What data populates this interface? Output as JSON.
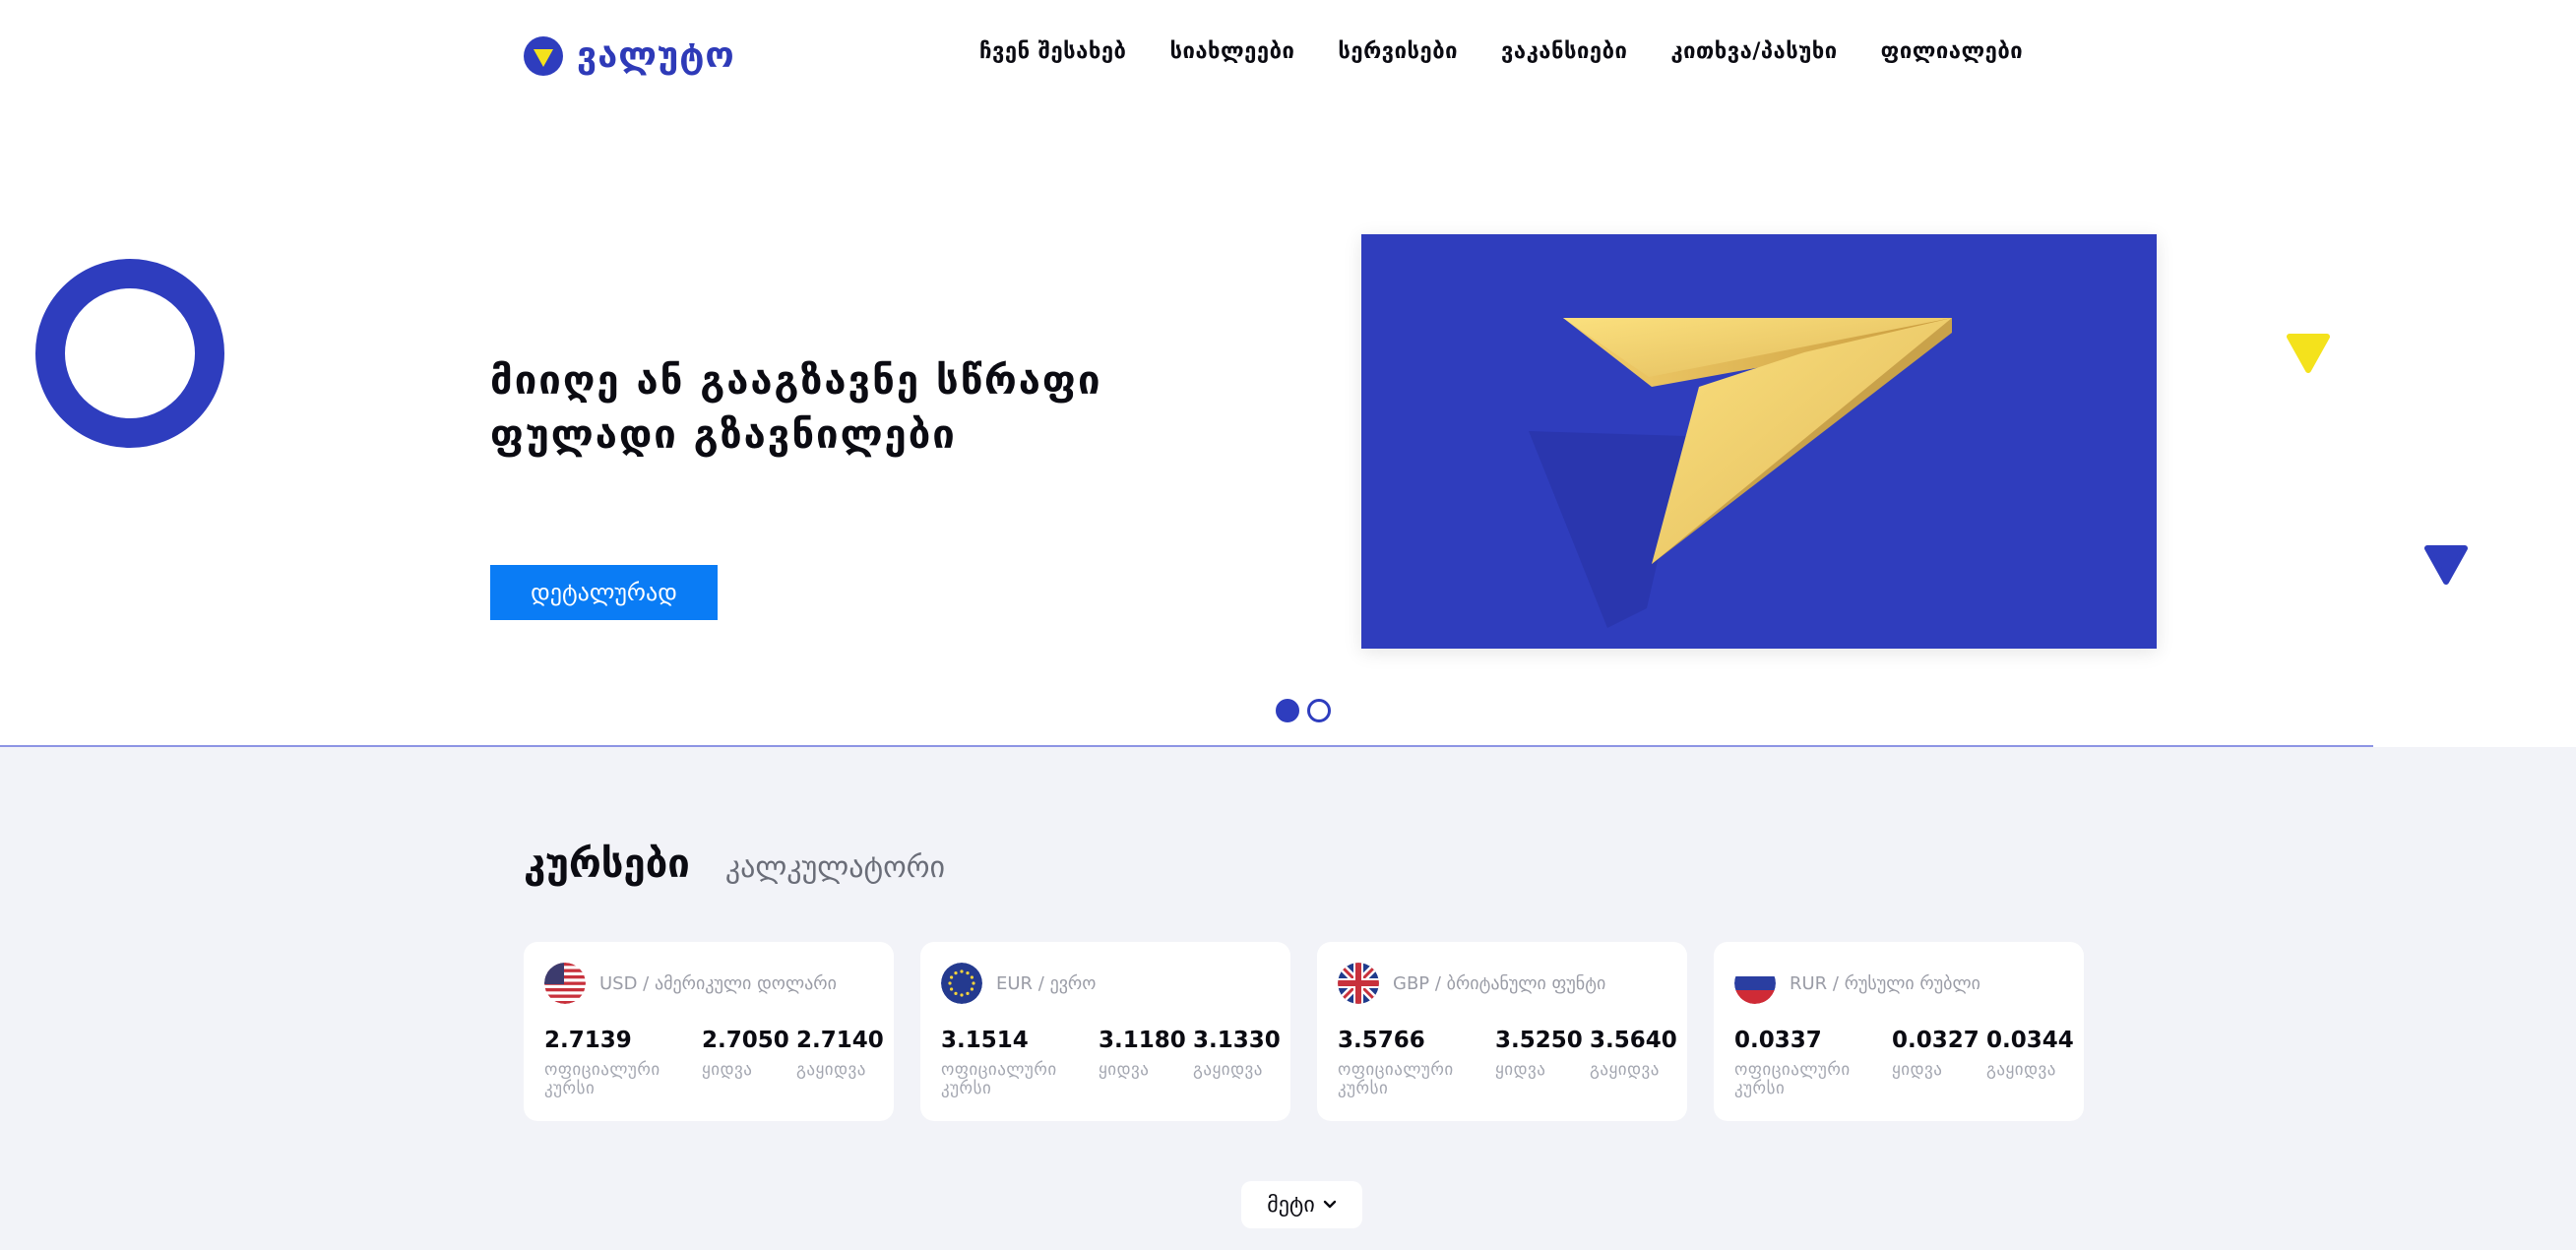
{
  "header": {
    "logo_text": "ვალუტო",
    "nav": [
      "ჩვენ შესახებ",
      "სიახლეები",
      "სერვისები",
      "ვაკანსიები",
      "კითხვა/პასუხი",
      "ფილიალები"
    ]
  },
  "hero": {
    "title_line1": "მიიღე ან გააგზავნე სწრაფი",
    "title_line2": "ფულადი გზავნილები",
    "button_label": "დეტალურად",
    "slides": 2,
    "active_slide": 1
  },
  "rates": {
    "tab_active": "კურსები",
    "tab_inactive": "კალკულატორი",
    "column_labels": {
      "official": "ოფიციალური კურსი",
      "buy": "ყიდვა",
      "sell": "გაყიდვა"
    },
    "currencies": [
      {
        "name": "USD / ამერიკული დოლარი",
        "official": "2.7139",
        "buy": "2.7050",
        "sell": "2.7140",
        "flag_icon": "usa-flag-icon"
      },
      {
        "name": "EUR / ევრო",
        "official": "3.1514",
        "buy": "3.1180",
        "sell": "3.1330",
        "flag_icon": "eu-flag-icon"
      },
      {
        "name": "GBP / ბრიტანული ფუნტი",
        "official": "3.5766",
        "buy": "3.5250",
        "sell": "3.5640",
        "flag_icon": "uk-flag-icon"
      },
      {
        "name": "RUR / რუსული რუბლი",
        "official": "0.0337",
        "buy": "0.0327",
        "sell": "0.0344",
        "flag_icon": "russia-flag-icon"
      }
    ],
    "more_label": "მეტი"
  },
  "colors": {
    "brand_blue": "#2e3dbe",
    "button_blue": "#0a7cf5",
    "accent_yellow": "#f4e21c",
    "section_bg": "#f2f3f8"
  }
}
